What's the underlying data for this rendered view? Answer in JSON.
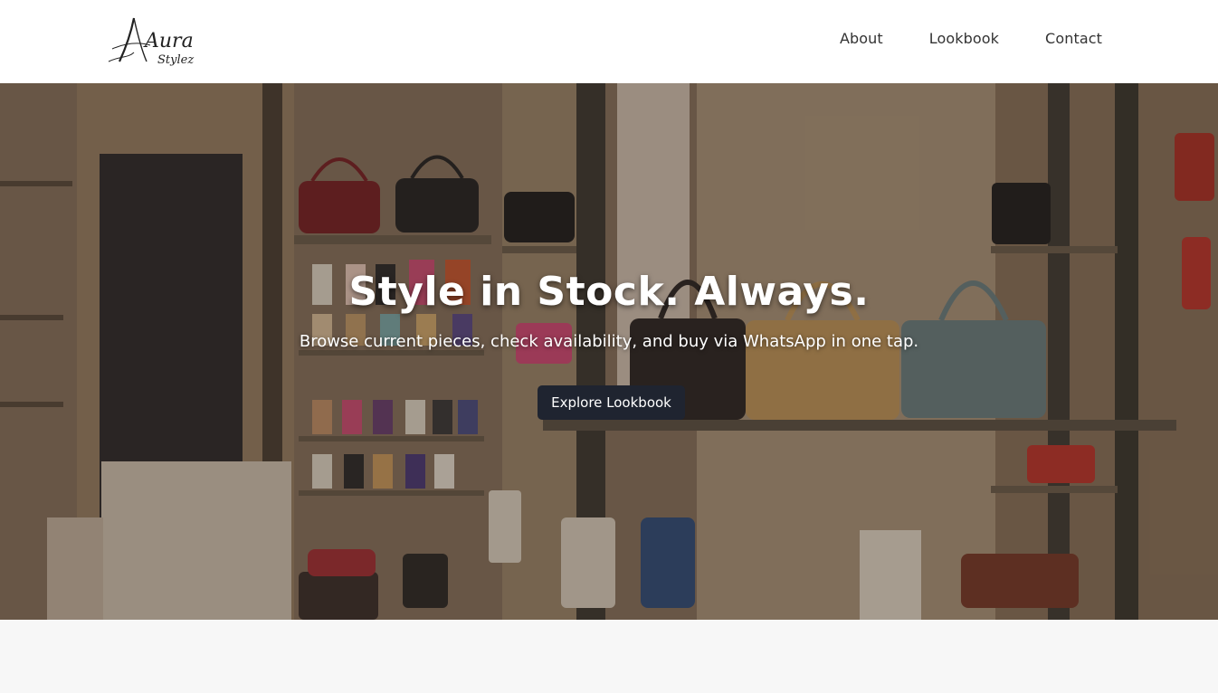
{
  "brand": {
    "name_main": "Aura",
    "name_sub": "Stylez"
  },
  "nav": {
    "items": [
      {
        "label": "About"
      },
      {
        "label": "Lookbook"
      },
      {
        "label": "Contact"
      }
    ]
  },
  "hero": {
    "title": "Style in Stock. Always.",
    "subtitle": "Browse current pieces, check availability, and buy via WhatsApp in one tap.",
    "cta_label": "Explore Lookbook",
    "image_alt_subject": "handbag-boutique-interior"
  },
  "colors": {
    "header_bg": "#ffffff",
    "nav_text": "#333333",
    "cta_bg": "#1f2430",
    "cta_text": "#ffffff",
    "page_bg": "#f7f7f7"
  }
}
